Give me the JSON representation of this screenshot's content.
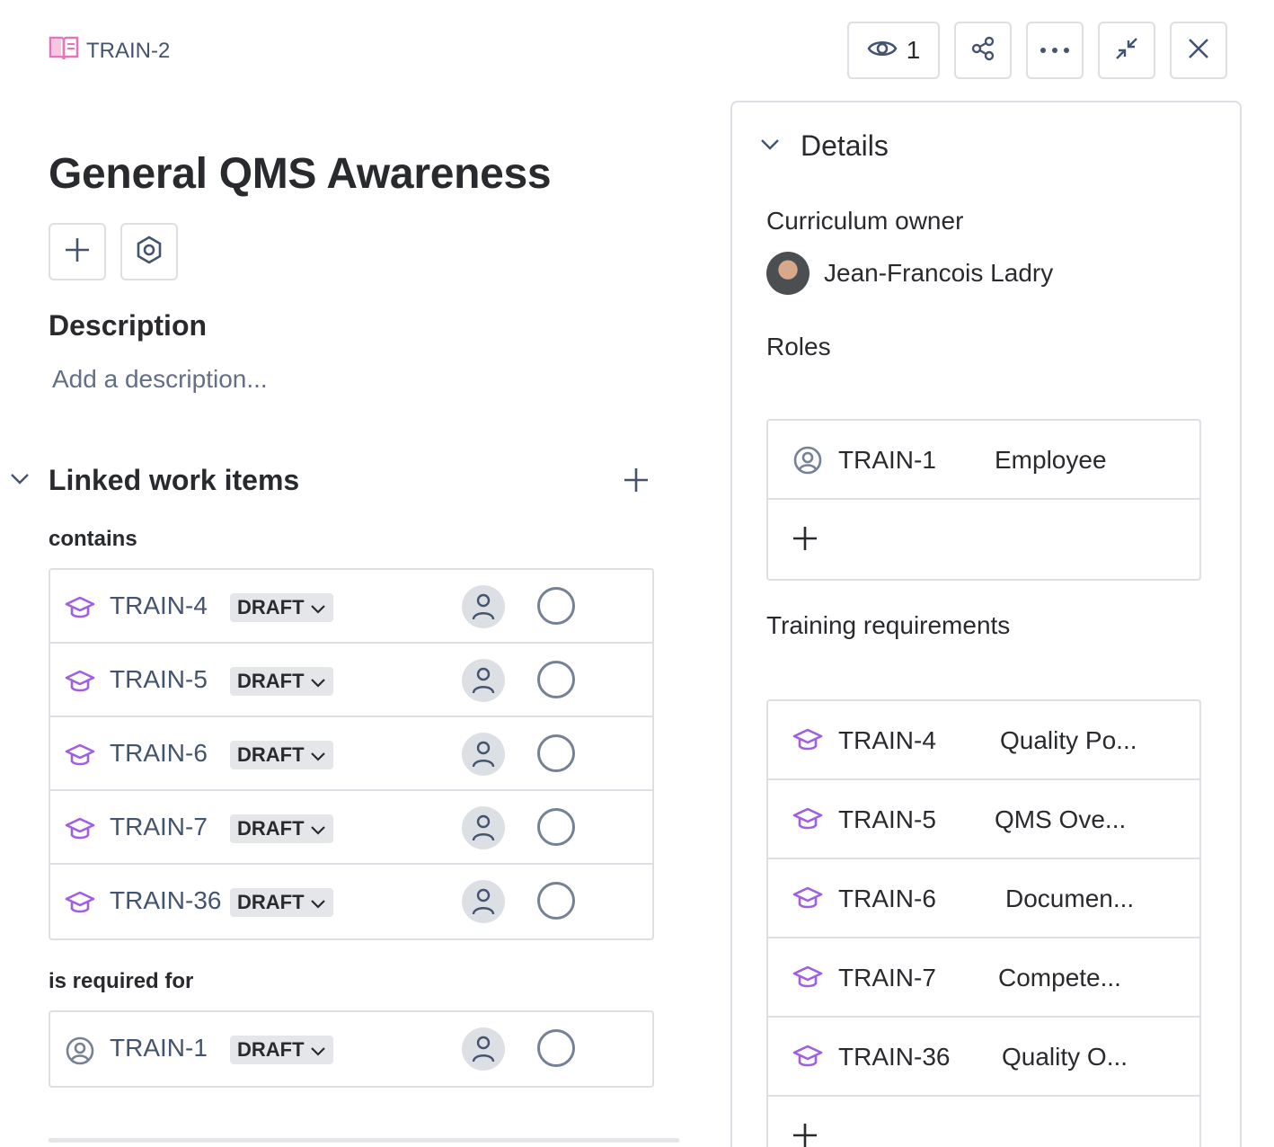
{
  "header": {
    "item_key": "TRAIN-2",
    "watchers_count": "1"
  },
  "title": "General QMS Awareness",
  "description": {
    "heading": "Description",
    "placeholder": "Add a description..."
  },
  "linked": {
    "heading": "Linked work items",
    "groups": [
      {
        "label": "contains",
        "items": [
          {
            "key": "TRAIN-4",
            "status": "DRAFT",
            "icon": "training-icon"
          },
          {
            "key": "TRAIN-5",
            "status": "DRAFT",
            "icon": "training-icon"
          },
          {
            "key": "TRAIN-6",
            "status": "DRAFT",
            "icon": "training-icon"
          },
          {
            "key": "TRAIN-7",
            "status": "DRAFT",
            "icon": "training-icon"
          },
          {
            "key": "TRAIN-36",
            "status": "DRAFT",
            "icon": "training-icon"
          }
        ]
      },
      {
        "label": "is required for",
        "items": [
          {
            "key": "TRAIN-1",
            "status": "DRAFT",
            "icon": "role-icon"
          }
        ]
      }
    ]
  },
  "details": {
    "heading": "Details",
    "owner_label": "Curriculum owner",
    "owner_name": "Jean-Francois Ladry",
    "roles_label": "Roles",
    "roles": [
      {
        "key": "TRAIN-1",
        "summary": "Employee"
      }
    ],
    "requirements_label": "Training requirements",
    "requirements": [
      {
        "key": "TRAIN-4",
        "summary": "Quality Po..."
      },
      {
        "key": "TRAIN-5",
        "summary": "QMS Ove..."
      },
      {
        "key": "TRAIN-6",
        "summary": "Documen..."
      },
      {
        "key": "TRAIN-7",
        "summary": "Compete..."
      },
      {
        "key": "TRAIN-36",
        "summary": "Quality O..."
      }
    ]
  },
  "colors": {
    "training_icon": "#a05ee6",
    "book_icon": "#e774bb",
    "status_bg": "#e4e6ea",
    "border": "#dcdfe4"
  }
}
